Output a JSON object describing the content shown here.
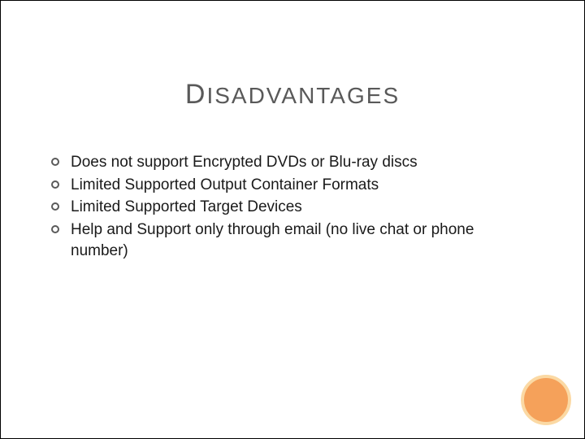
{
  "slide": {
    "title_first": "D",
    "title_rest": "ISADVANTAGES",
    "bullets": [
      "Does not support Encrypted DVDs or Blu-ray discs",
      "Limited Supported Output Container Formats",
      "Limited Supported Target Devices",
      "Help and Support only through email (no live chat or phone number)"
    ]
  }
}
